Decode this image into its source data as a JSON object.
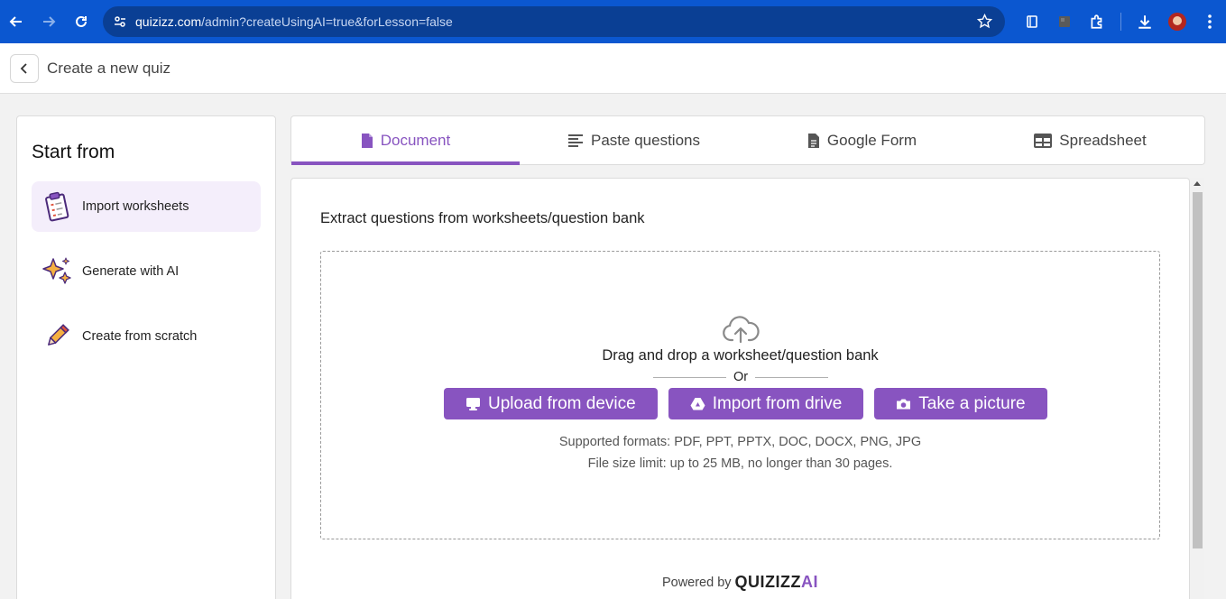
{
  "browser": {
    "url_host": "quizizz.com",
    "url_path": "/admin?createUsingAI=true&forLesson=false"
  },
  "header": {
    "title": "Create a new quiz"
  },
  "sidebar": {
    "title": "Start from",
    "items": [
      {
        "label": "Import worksheets",
        "icon": "clipboard-icon",
        "active": true
      },
      {
        "label": "Generate with AI",
        "icon": "sparkles-icon",
        "active": false
      },
      {
        "label": "Create from scratch",
        "icon": "pencil-icon",
        "active": false
      }
    ]
  },
  "tabs": [
    {
      "label": "Document",
      "icon": "document-icon",
      "active": true
    },
    {
      "label": "Paste questions",
      "icon": "lines-icon",
      "active": false
    },
    {
      "label": "Google Form",
      "icon": "form-icon",
      "active": false
    },
    {
      "label": "Spreadsheet",
      "icon": "table-icon",
      "active": false
    }
  ],
  "main": {
    "heading": "Extract questions from worksheets/question bank",
    "drop_text": "Drag and drop a worksheet/question bank",
    "or_text": "Or",
    "buttons": {
      "upload": "Upload from device",
      "drive": "Import from drive",
      "picture": "Take a picture"
    },
    "formats": "Supported formats: PDF, PPT, PPTX, DOC, DOCX, PNG, JPG",
    "size_limit": "File size limit: up to 25 MB, no longer than 30 pages.",
    "powered_by": "Powered by",
    "brand": "QUIZIZZ",
    "brand_ai": "AI"
  },
  "colors": {
    "accent": "#8854c0",
    "browser_bar": "#0b57d0"
  }
}
